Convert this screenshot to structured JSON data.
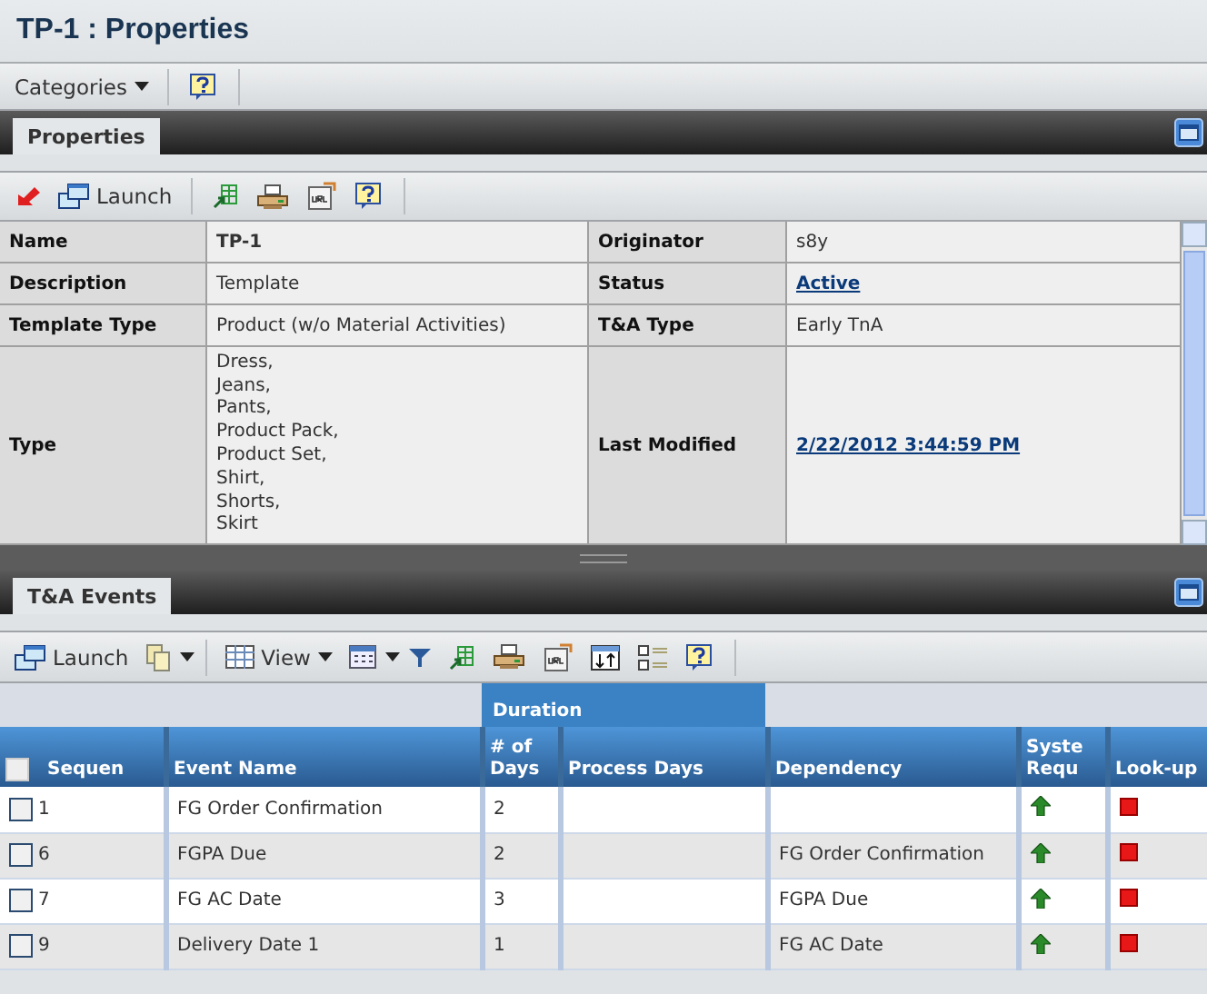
{
  "title": "TP-1 : Properties",
  "top_toolbar": {
    "categories": "Categories"
  },
  "properties_panel": {
    "tabs": [
      {
        "label": "Properties",
        "selected": true
      }
    ],
    "toolbar": {
      "launch": "Launch"
    },
    "rows": [
      {
        "cells": [
          {
            "label": "Name",
            "value": "TP-1",
            "kind": "bold"
          },
          {
            "label": "Originator",
            "value": "s8y",
            "kind": "text"
          }
        ]
      },
      {
        "cells": [
          {
            "label": "Description",
            "value": "Template",
            "kind": "text"
          },
          {
            "label": "Status",
            "value": "Active",
            "kind": "link"
          }
        ]
      },
      {
        "cells": [
          {
            "label": "Template Type",
            "value": "Product (w/o Material Activities)",
            "kind": "text"
          },
          {
            "label": "T&A Type",
            "value": "Early TnA",
            "kind": "text"
          }
        ]
      },
      {
        "cells": [
          {
            "label": "Type",
            "lines": [
              "Dress,",
              "Jeans,",
              "Pants,",
              "Product Pack,",
              "Product Set,",
              "Shirt,",
              "Shorts,",
              "Skirt"
            ],
            "kind": "list"
          },
          {
            "label": "Last Modified",
            "value": "2/22/2012 3:44:59 PM",
            "kind": "link"
          }
        ]
      }
    ]
  },
  "events_panel": {
    "tabs": [
      {
        "label": "T&A Events",
        "selected": true
      }
    ],
    "toolbar": {
      "launch": "Launch",
      "view": "View"
    },
    "group_header": "Duration",
    "columns": [
      "Sequen",
      "Event Name",
      "# of Days",
      "Process Days",
      "Dependency",
      "Syste Requ",
      "Look-up"
    ],
    "select_all": {
      "checked": false
    },
    "rows": [
      {
        "checked": false,
        "sequence": "1",
        "event_name": "FG Order Confirmation",
        "days": "2",
        "process_days": "",
        "dependency": ""
      },
      {
        "checked": false,
        "sequence": "6",
        "event_name": "FGPA Due",
        "days": "2",
        "process_days": "",
        "dependency": "FG Order Confirmation"
      },
      {
        "checked": false,
        "sequence": "7",
        "event_name": "FG AC Date",
        "days": "3",
        "process_days": "",
        "dependency": "FGPA Due"
      },
      {
        "checked": false,
        "sequence": "9",
        "event_name": "Delivery Date 1",
        "days": "1",
        "process_days": "",
        "dependency": "FG AC Date"
      }
    ]
  }
}
